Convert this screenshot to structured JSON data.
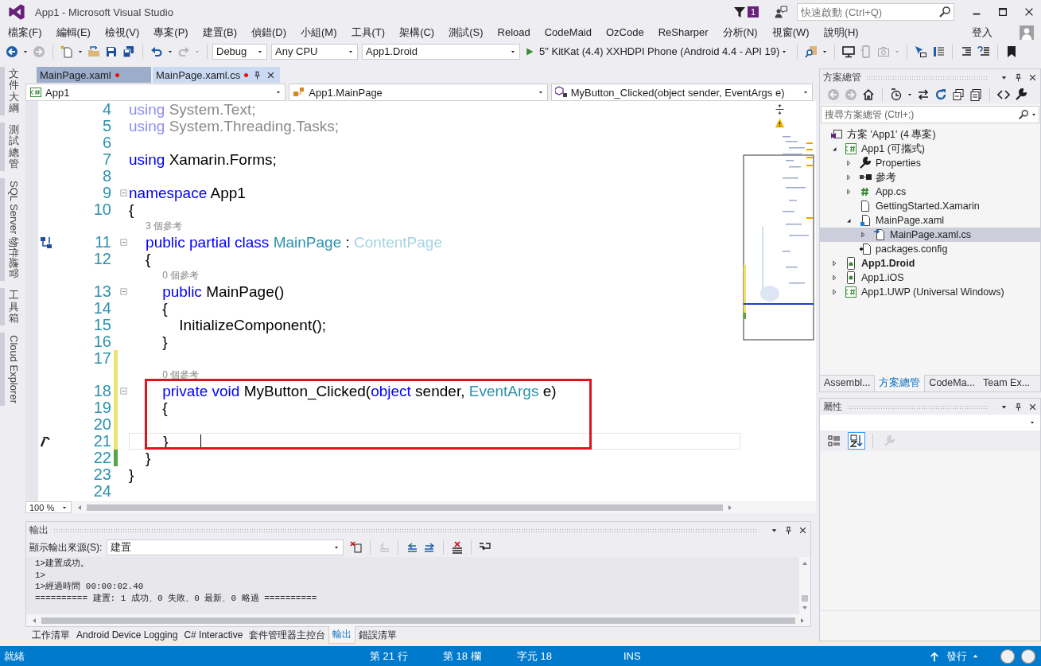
{
  "window": {
    "title": "App1 - Microsoft Visual Studio",
    "notifications": "1",
    "quick_launch": {
      "placeholder": "快速啟動 (Ctrl+Q)"
    }
  },
  "menu": [
    "檔案(F)",
    "編輯(E)",
    "檢視(V)",
    "專案(P)",
    "建置(B)",
    "偵錯(D)",
    "小組(M)",
    "工具(T)",
    "架構(C)",
    "測試(S)",
    "Reload",
    "CodeMaid",
    "OzCode",
    "ReSharper",
    "分析(N)",
    "視窗(W)",
    "說明(H)"
  ],
  "account": {
    "label": "登入"
  },
  "toolbar": {
    "groups": [
      [
        {
          "kind": "back",
          "disabled": false,
          "menu": true
        },
        {
          "kind": "forward",
          "disabled": true,
          "menu": false
        }
      ],
      [
        {
          "kind": "new",
          "disabled": false,
          "menu": true
        },
        {
          "kind": "open",
          "disabled": false,
          "menu": false
        },
        {
          "kind": "save",
          "disabled": false,
          "menu": false
        },
        {
          "kind": "saveall",
          "disabled": false,
          "menu": false
        }
      ],
      [
        {
          "kind": "undo",
          "disabled": false,
          "menu": true
        },
        {
          "kind": "redo",
          "disabled": true,
          "menu": true
        }
      ]
    ],
    "configuration": "Debug",
    "platform": "Any CPU",
    "startup_project": "App1.Droid",
    "run_target": "5\" KitKat (4.4) XXHDPI Phone (Android 4.4 - API 19)",
    "tools": [
      [
        {
          "kind": "find",
          "disabled": false,
          "menu": true
        }
      ],
      [
        {
          "kind": "monitor",
          "disabled": false,
          "menu": false
        },
        {
          "kind": "phone",
          "disabled": true,
          "menu": false
        },
        {
          "kind": "camera",
          "disabled": true,
          "menu": true
        }
      ],
      [
        {
          "kind": "pointer",
          "disabled": false,
          "menu": false
        },
        {
          "kind": "list",
          "disabled": false,
          "menu": false
        }
      ],
      [
        {
          "kind": "indent",
          "disabled": false,
          "menu": false
        },
        {
          "kind": "comment",
          "disabled": false,
          "menu": false
        }
      ],
      [
        {
          "kind": "bookmark",
          "disabled": false,
          "menu": false
        }
      ]
    ]
  },
  "side_tabs": [
    {
      "label": "文件大綱",
      "kind": "upright"
    },
    {
      "label": "測試總管",
      "kind": "upright"
    },
    {
      "label": "SQL Server 物件總管",
      "kind": "rotated"
    },
    {
      "label": "工具箱",
      "kind": "upright"
    },
    {
      "label": "Cloud Explorer",
      "kind": "rotated"
    }
  ],
  "document_tabs": [
    {
      "label": "MainPage.xaml",
      "modified": true,
      "selected": false
    },
    {
      "label": "MainPage.xaml.cs",
      "modified": true,
      "selected": true
    }
  ],
  "navigation": {
    "project": "App1",
    "type": "App1.MainPage",
    "member": "MyButton_Clicked(object sender, EventArgs e)"
  },
  "code": {
    "rows": [
      {
        "kind": "line",
        "number": "4",
        "foldable": false,
        "current": false,
        "boxed": false,
        "tokens": [
          {
            "text": "using",
            "kind": "faded-keyword"
          },
          {
            "text": " System.Text;",
            "kind": "faded"
          }
        ]
      },
      {
        "kind": "line",
        "number": "5",
        "foldable": false,
        "current": false,
        "boxed": false,
        "tokens": [
          {
            "text": "using",
            "kind": "faded-keyword"
          },
          {
            "text": " System.Threading.Tasks;",
            "kind": "faded"
          }
        ]
      },
      {
        "kind": "line",
        "number": "6",
        "foldable": false,
        "current": false,
        "boxed": false,
        "tokens": []
      },
      {
        "kind": "line",
        "number": "7",
        "foldable": false,
        "current": false,
        "boxed": false,
        "tokens": [
          {
            "text": "using",
            "kind": "keyword"
          },
          {
            "text": " Xamarin.Forms;",
            "kind": "plain"
          }
        ]
      },
      {
        "kind": "line",
        "number": "8",
        "foldable": false,
        "current": false,
        "boxed": false,
        "tokens": []
      },
      {
        "kind": "line",
        "number": "9",
        "foldable": true,
        "current": false,
        "boxed": false,
        "tokens": [
          {
            "text": "namespace",
            "kind": "keyword"
          },
          {
            "text": " App1",
            "kind": "plain"
          }
        ]
      },
      {
        "kind": "line",
        "number": "10",
        "foldable": false,
        "current": false,
        "boxed": false,
        "tokens": [
          {
            "text": "{",
            "kind": "plain"
          }
        ]
      },
      {
        "kind": "codelens",
        "text": "3 個參考"
      },
      {
        "kind": "line",
        "number": "11",
        "foldable": true,
        "current": false,
        "boxed": false,
        "glyph": {
          "kind": "hierarchy"
        },
        "tokens": [
          {
            "text": "    public partial class",
            "kind": "keyword"
          },
          {
            "text": " MainPage",
            "kind": "type"
          },
          {
            "text": " : ",
            "kind": "plain"
          },
          {
            "text": "ContentPage",
            "kind": "faded-type"
          }
        ]
      },
      {
        "kind": "line",
        "number": "12",
        "foldable": false,
        "current": false,
        "boxed": false,
        "tokens": [
          {
            "text": "    {",
            "kind": "plain"
          }
        ]
      },
      {
        "kind": "codelens",
        "text": "0 個參考"
      },
      {
        "kind": "line",
        "number": "13",
        "foldable": true,
        "current": false,
        "boxed": false,
        "tokens": [
          {
            "text": "        public",
            "kind": "keyword"
          },
          {
            "text": " MainPage()",
            "kind": "plain"
          }
        ]
      },
      {
        "kind": "line",
        "number": "14",
        "foldable": false,
        "current": false,
        "boxed": false,
        "tokens": [
          {
            "text": "        {",
            "kind": "plain"
          }
        ]
      },
      {
        "kind": "line",
        "number": "15",
        "foldable": false,
        "current": false,
        "boxed": false,
        "tokens": [
          {
            "text": "            InitializeComponent();",
            "kind": "plain"
          }
        ]
      },
      {
        "kind": "line",
        "number": "16",
        "foldable": false,
        "current": false,
        "boxed": false,
        "tokens": [
          {
            "text": "        }",
            "kind": "plain"
          }
        ]
      },
      {
        "kind": "line",
        "number": "17",
        "foldable": false,
        "current": false,
        "boxed": false,
        "modified": true,
        "tokens": []
      },
      {
        "kind": "codelens",
        "text": "0 個參考",
        "modified": true
      },
      {
        "kind": "line",
        "number": "18",
        "foldable": true,
        "current": false,
        "boxed": true,
        "modified": true,
        "tokens": [
          {
            "text": "        private void",
            "kind": "keyword"
          },
          {
            "text": " MyButton_Clicked(",
            "kind": "plain"
          },
          {
            "text": "object",
            "kind": "keyword"
          },
          {
            "text": " sender, ",
            "kind": "plain"
          },
          {
            "text": "EventArgs",
            "kind": "type"
          },
          {
            "text": " e)",
            "kind": "plain"
          }
        ]
      },
      {
        "kind": "line",
        "number": "19",
        "foldable": false,
        "current": false,
        "boxed": true,
        "modified": true,
        "tokens": [
          {
            "text": "        {",
            "kind": "plain"
          }
        ]
      },
      {
        "kind": "line",
        "number": "20",
        "foldable": false,
        "current": false,
        "boxed": true,
        "modified": true,
        "tokens": []
      },
      {
        "kind": "line",
        "number": "21",
        "foldable": false,
        "current": true,
        "boxed": true,
        "modified": true,
        "glyph": {
          "kind": "hammer"
        },
        "tokens": [
          {
            "text": "        }",
            "kind": "plain"
          }
        ]
      },
      {
        "kind": "line",
        "number": "22",
        "foldable": false,
        "current": false,
        "boxed": false,
        "saved": true,
        "tokens": [
          {
            "text": "    }",
            "kind": "plain"
          }
        ]
      },
      {
        "kind": "line",
        "number": "23",
        "foldable": false,
        "current": false,
        "boxed": false,
        "tokens": [
          {
            "text": "}",
            "kind": "plain"
          }
        ]
      },
      {
        "kind": "line",
        "number": "24",
        "foldable": false,
        "current": false,
        "boxed": false,
        "tokens": []
      }
    ]
  },
  "zoom": "100 %",
  "output": {
    "title": "輸出",
    "source_label": "顯示輸出來源(S):",
    "source": "建置",
    "tools": [
      [
        {
          "kind": "locate",
          "disabled": false
        }
      ],
      [
        {
          "kind": "prevpage",
          "disabled": true
        }
      ],
      [
        {
          "kind": "prev",
          "disabled": false
        },
        {
          "kind": "next",
          "disabled": false
        }
      ],
      [
        {
          "kind": "clear",
          "disabled": false
        }
      ],
      [
        {
          "kind": "wrap",
          "disabled": false
        }
      ]
    ],
    "lines": [
      "1>建置成功。",
      "1>",
      "1>經過時間 00:00:02.40",
      "========== 建置: 1 成功、0 失敗、0 最新、0 略過 =========="
    ]
  },
  "bottom_tabs": [
    {
      "label": "工作清單",
      "selected": false
    },
    {
      "label": "Android Device Logging",
      "selected": false
    },
    {
      "label": "C# Interactive",
      "selected": false
    },
    {
      "label": "套件管理器主控台",
      "selected": false
    },
    {
      "label": "輸出",
      "selected": true
    },
    {
      "label": "錯誤清單",
      "selected": false
    }
  ],
  "solution_explorer": {
    "title": "方案總管",
    "tools": [
      [
        {
          "kind": "back",
          "disabled": true,
          "menu": false
        },
        {
          "kind": "forward",
          "disabled": true,
          "menu": false
        },
        {
          "kind": "home",
          "disabled": false,
          "menu": false
        }
      ],
      [
        {
          "kind": "pending",
          "disabled": false,
          "menu": true
        },
        {
          "kind": "sync",
          "disabled": false,
          "menu": false
        },
        {
          "kind": "refresh",
          "disabled": false,
          "menu": false
        },
        {
          "kind": "collapse",
          "disabled": false,
          "menu": false
        },
        {
          "kind": "showfiles",
          "disabled": false,
          "menu": false
        }
      ],
      [
        {
          "kind": "code",
          "disabled": false,
          "menu": false
        },
        {
          "kind": "wrench",
          "disabled": false,
          "menu": false
        }
      ]
    ],
    "search": {
      "placeholder": "搜尋方案總管 (Ctrl+;)"
    },
    "tree": [
      {
        "label": "方案 'App1' (4 專案)",
        "kind": "solution",
        "selected": false,
        "children": [
          {
            "label": "App1 (可攜式)",
            "kind": "project",
            "startup": false,
            "selected": false,
            "expanded": true,
            "children": [
              {
                "label": "Properties",
                "kind": "properties",
                "selected": false,
                "expanded": false
              },
              {
                "label": "參考",
                "kind": "references",
                "selected": false,
                "expanded": false
              },
              {
                "label": "App.cs",
                "kind": "csharp",
                "selected": false,
                "expanded": false
              },
              {
                "label": "GettingStarted.Xamarin",
                "kind": "file",
                "selected": false
              },
              {
                "label": "MainPage.xaml",
                "kind": "xaml",
                "selected": false,
                "expanded": true,
                "children": [
                  {
                    "label": "MainPage.xaml.cs",
                    "kind": "codebehind",
                    "selected": true,
                    "expanded": false
                  }
                ]
              },
              {
                "label": "packages.config",
                "kind": "config",
                "selected": false
              }
            ]
          },
          {
            "label": "App1.Droid",
            "kind": "android",
            "startup": true,
            "selected": false,
            "expanded": false
          },
          {
            "label": "App1.iOS",
            "kind": "ios",
            "startup": false,
            "selected": false,
            "expanded": false
          },
          {
            "label": "App1.UWP (Universal Windows)",
            "kind": "project",
            "startup": false,
            "selected": false,
            "expanded": false
          }
        ]
      }
    ],
    "tabs": [
      {
        "label": "Assembl...",
        "selected": false
      },
      {
        "label": "方案總管",
        "selected": true
      },
      {
        "label": "CodeMa...",
        "selected": false
      },
      {
        "label": "Team Ex...",
        "selected": false
      }
    ]
  },
  "properties": {
    "title": "屬性",
    "tools": [
      {
        "kind": "categorized",
        "selected": false,
        "disabled": false
      },
      {
        "kind": "alphabetical",
        "selected": true,
        "disabled": false
      },
      {
        "kind": "propertypages",
        "selected": false,
        "disabled": true
      }
    ]
  },
  "status_bar": {
    "message": "就緒",
    "line": "第 21 行",
    "column": "第 18 欄",
    "char": "字元 18",
    "mode": "INS",
    "publish": "發行"
  }
}
